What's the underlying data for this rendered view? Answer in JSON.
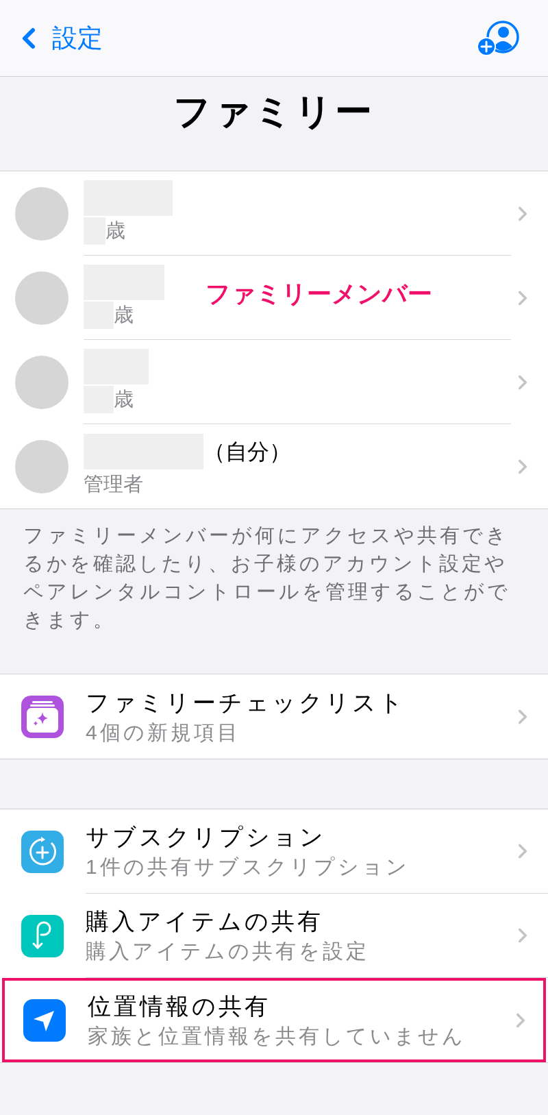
{
  "nav": {
    "back": "設定"
  },
  "title": "ファミリー",
  "members": [
    {
      "subtitle": "歳"
    },
    {
      "subtitle": "歳"
    },
    {
      "subtitle": "歳"
    },
    {
      "name_suffix": "（自分）",
      "subtitle": "管理者"
    }
  ],
  "annotation": "ファミリーメンバー",
  "members_footer": "ファミリーメンバーが何にアクセスや共有できるかを確認したり、お子様のアカウント設定やペアレンタルコントロールを管理することができます。",
  "sections": [
    [
      {
        "kind": "checklist",
        "title": "ファミリーチェックリスト",
        "subtitle": "4個の新規項目",
        "highlighted": false
      }
    ],
    [
      {
        "kind": "subscriptions",
        "title": "サブスクリプション",
        "subtitle": "1件の共有サブスクリプション",
        "highlighted": false
      },
      {
        "kind": "purchases",
        "title": "購入アイテムの共有",
        "subtitle": "購入アイテムの共有を設定",
        "highlighted": false
      },
      {
        "kind": "location",
        "title": "位置情報の共有",
        "subtitle": "家族と位置情報を共有していません",
        "highlighted": true
      }
    ]
  ]
}
